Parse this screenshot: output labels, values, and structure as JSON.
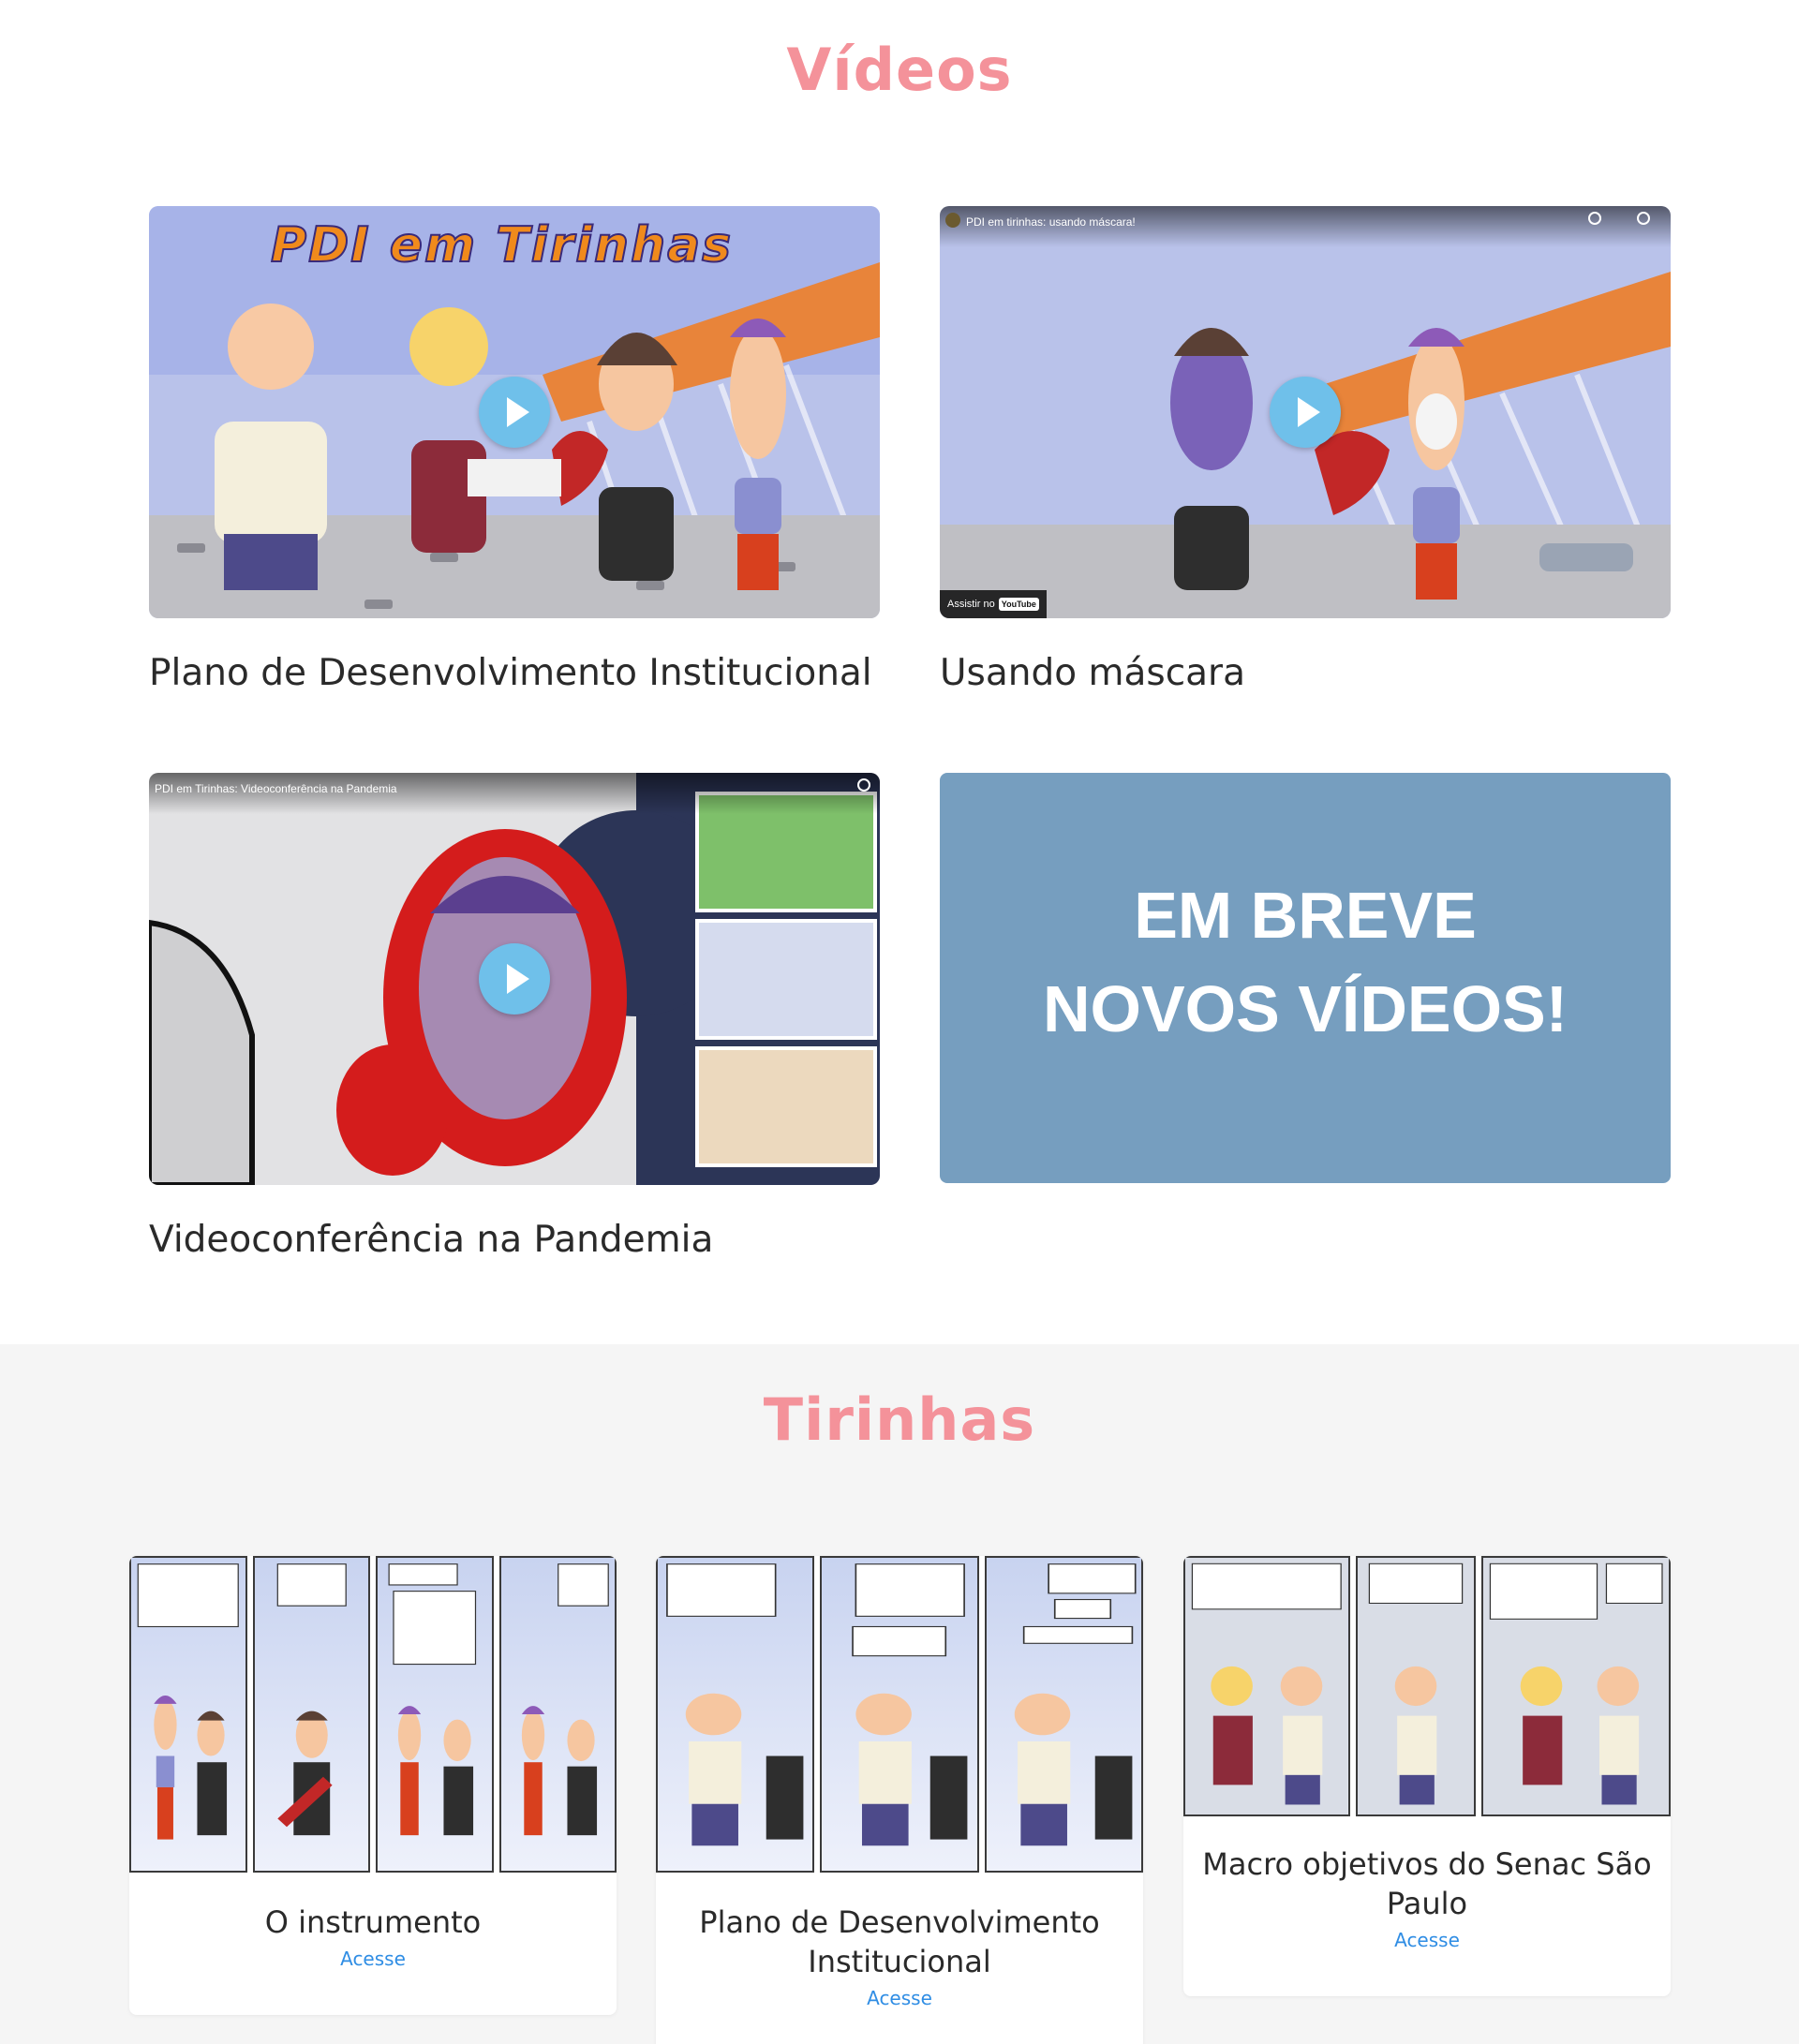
{
  "videos": {
    "title": "Vídeos",
    "items": [
      {
        "caption": "Plano de Desenvolvimento Institucional",
        "logo_text": "PDI em Tirinhas"
      },
      {
        "caption": "Usando máscara",
        "player_title": "PDI em tirinhas: usando máscara!",
        "watch_on": "Assistir no",
        "yt_label": "YouTube"
      },
      {
        "caption": "Videoconferência na Pandemia",
        "player_title": "PDI em Tirinhas: Videoconferência na Pandemia"
      }
    ],
    "coming_soon": {
      "line1": "EM BREVE",
      "line2": "NOVOS VÍDEOS!"
    }
  },
  "tirinhas": {
    "title": "Tirinhas",
    "items": [
      {
        "title": "O instrumento",
        "link": "Acesse"
      },
      {
        "title": "Plano de Desenvolvimento Institucional",
        "link": "Acesse"
      },
      {
        "title": "Macro objetivos do Senac São Paulo",
        "link": "Acesse"
      }
    ]
  },
  "colors": {
    "heading_pink": "#f4929a",
    "coming_soon_bg": "#769ebf",
    "link_blue": "#2f8de4",
    "play_button": "#6fc0ea"
  }
}
